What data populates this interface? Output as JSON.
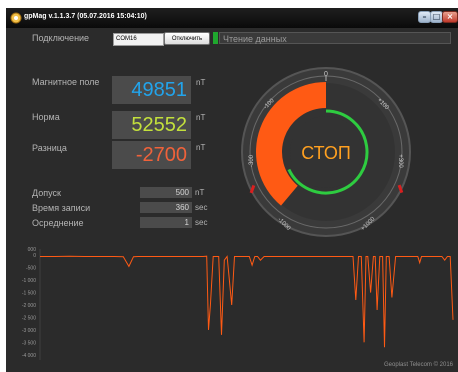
{
  "window": {
    "title": "gpMag v.1.1.3.7 (05.07.2016 15:04:10)",
    "controls": [
      "minimize-icon",
      "maximize-icon",
      "close-icon"
    ]
  },
  "connection": {
    "label": "Подключение",
    "port": "COM16",
    "disconnect_button": "Отключить",
    "status": "Чтение данных"
  },
  "readings": {
    "magnetic_field_label": "Магнитное поле",
    "magnetic_field_value": "49851",
    "norm_label": "Норма",
    "norm_value": "52552",
    "difference_label": "Разница",
    "difference_value": "-2700",
    "unit": "nT"
  },
  "params": {
    "tolerance_label": "Допуск",
    "tolerance_value": "500",
    "tolerance_unit": "nT",
    "record_time_label": "Время записи",
    "record_time_value": "360",
    "record_time_unit": "sec",
    "averaging_label": "Осреднение",
    "averaging_value": "1",
    "averaging_unit": "sec"
  },
  "gauge": {
    "center_text": "СТОП",
    "scale_labels": [
      "0",
      "+100",
      "+300",
      "+1000",
      "-1000",
      "-300",
      "-100"
    ],
    "range": [
      -1000,
      1000
    ],
    "bar_value": -2700,
    "green_arc_level": 0.68,
    "colors": {
      "bar": "#ff5a14",
      "green_arc": "#2ecc40",
      "center_text": "#ffa020",
      "red_marks": "#d91f1f"
    }
  },
  "chart_data": {
    "type": "line",
    "title": "",
    "xlabel": "",
    "ylabel": "",
    "ylim": [
      -4250,
      250
    ],
    "yticks": [
      "000",
      "0",
      "-500",
      "-1 000",
      "-1 500",
      "-2 000",
      "-2 500",
      "-3 000",
      "-3 500",
      "-4 000"
    ],
    "x": [
      0,
      16,
      32,
      48,
      64,
      80,
      90,
      96,
      101,
      106,
      112,
      128,
      144,
      160,
      176,
      180,
      182,
      184,
      187,
      190,
      193,
      196,
      199,
      202,
      204,
      207,
      210,
      214,
      218,
      222,
      226,
      229,
      232,
      235,
      238,
      242,
      246,
      250,
      254,
      258,
      262,
      266,
      270,
      274,
      278,
      282,
      286,
      290,
      294,
      298,
      302,
      306,
      310,
      314,
      318,
      322,
      326,
      330,
      334,
      338,
      341,
      344,
      347,
      350,
      352,
      354,
      357,
      360,
      362,
      364,
      367,
      370,
      372,
      374,
      377,
      380,
      384,
      388,
      392,
      396,
      400,
      404,
      408,
      410,
      412,
      414,
      418,
      422,
      426,
      430,
      434,
      437,
      440,
      443,
      446
    ],
    "series": [
      {
        "values": [
          -50,
          -50,
          -40,
          -50,
          -50,
          -50,
          -60,
          -450,
          -60,
          -50,
          -50,
          -50,
          -50,
          -50,
          -50,
          -40,
          -3000,
          -2000,
          -50,
          -50,
          -50,
          -3200,
          -200,
          -50,
          -800,
          -2000,
          -50,
          -50,
          -50,
          -50,
          -50,
          -400,
          -50,
          -50,
          -200,
          -50,
          -50,
          -50,
          -50,
          -50,
          -50,
          -50,
          -50,
          -50,
          -50,
          -50,
          -50,
          -50,
          -50,
          -50,
          -50,
          -50,
          -50,
          -50,
          -50,
          -50,
          -50,
          -50,
          -50,
          -50,
          -1800,
          -50,
          -50,
          -3500,
          -50,
          -50,
          -1500,
          -50,
          -50,
          -2200,
          -50,
          -50,
          -3700,
          -50,
          -50,
          -1700,
          -50,
          -50,
          -50,
          -50,
          -50,
          -50,
          -50,
          -300,
          -50,
          -50,
          -50,
          -50,
          -50,
          -50,
          -50,
          -200,
          -50,
          -50,
          -2600
        ]
      }
    ],
    "line_color": "#ff5a14",
    "grid": false
  },
  "footer": "Geoplast Telecom © 2016"
}
